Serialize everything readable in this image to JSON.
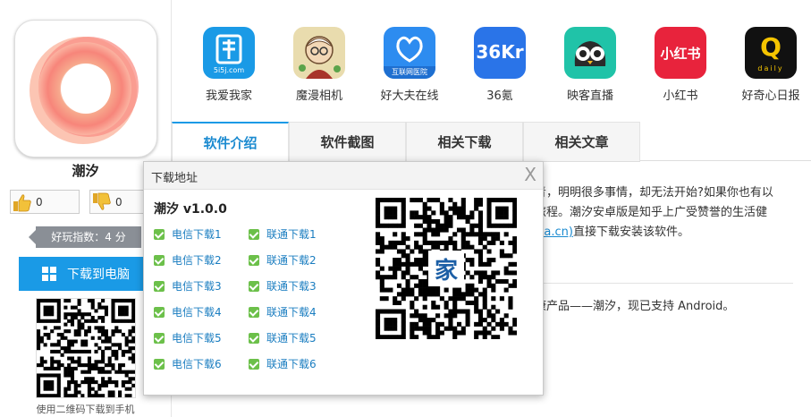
{
  "app": {
    "name": "潮汐",
    "like_count": "0",
    "dislike_count": "0",
    "score_text": "好玩指数：4 分",
    "download_pc_label": "下载到电脑",
    "qr_caption": "使用二维码下载到手机"
  },
  "related_apps": [
    {
      "label": "我爱我家",
      "icon": "woaiwojia-icon",
      "color": "#1a9ae6"
    },
    {
      "label": "魔漫相机",
      "icon": "momanxiangji-icon",
      "color": "#e9d9a8"
    },
    {
      "label": "好大夫在线",
      "icon": "haodaifu-icon",
      "color": "#2d8cf0"
    },
    {
      "label": "36氪",
      "icon": "36kr-icon",
      "color": "#2a74e8"
    },
    {
      "label": "映客直播",
      "icon": "yingke-icon",
      "color": "#20c3a8"
    },
    {
      "label": "小红书",
      "icon": "xiaohongshu-icon",
      "color": "#e8233c"
    },
    {
      "label": "好奇心日报",
      "icon": "haoqixin-icon",
      "color": "#111111"
    }
  ],
  "related_app_texts": {
    "woaiwojia": "5i5j.com",
    "haodaifu": "互联网医院",
    "kr36": "36Kr",
    "xiaohongshu": "小红书",
    "haoqixin": "Q",
    "haoqixin_sub": "daily"
  },
  "tabs": [
    "软件介绍",
    "软件截图",
    "相关下载",
    "相关文章"
  ],
  "article": {
    "line1": "青，明明很多事情，却无法开始?如果你也有以",
    "line2": "旅程。潮汐安卓版是知乎上广受赞誉的生活健",
    "line3_link": "iza.cn)",
    "line3_rest": "直接下载安装该软件。",
    "line4": "康产品——潮汐，现已支持 Android。"
  },
  "dialog": {
    "title": "下载地址",
    "close": "X",
    "version": "潮汐 v1.0.0",
    "telecom": [
      "电信下载1",
      "电信下载2",
      "电信下载3",
      "电信下载4",
      "电信下载5",
      "电信下载6"
    ],
    "unicom": [
      "联通下载1",
      "联通下载2",
      "联通下载3",
      "联通下载4",
      "联通下载5",
      "联通下载6"
    ],
    "qr_badge": "家"
  },
  "colors": {
    "accent": "#1a9ae6",
    "link": "#1a7dc0",
    "check": "#6cc04a"
  }
}
